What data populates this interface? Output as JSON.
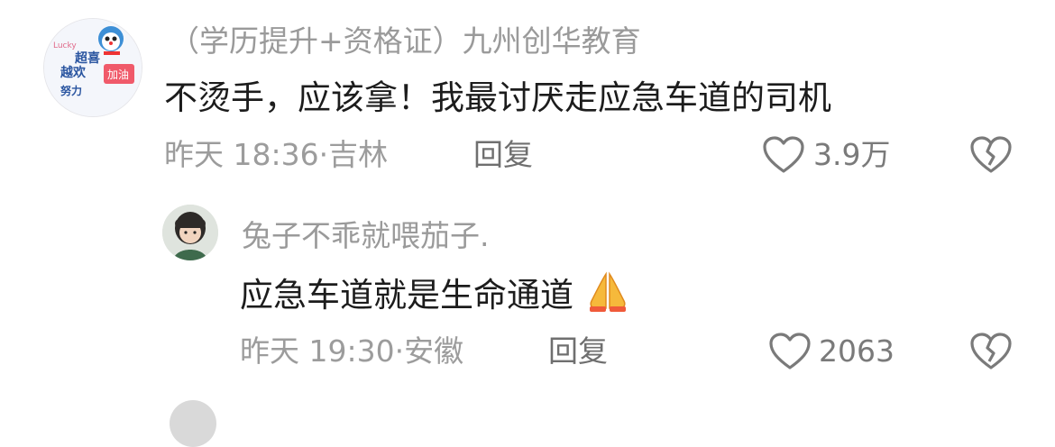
{
  "comment": {
    "author": "（学历提升+资格证）九州创华教育",
    "text": "不烫手，应该拿！我最讨厌走应急车道的司机",
    "time": "昨天 18:36·",
    "location": "吉林",
    "reply_label": "回复",
    "like_count": "3.9万",
    "avatar": {
      "text_lines": [
        "超喜",
        "越欢",
        "努力"
      ],
      "badge": "加油",
      "tag": "Lucky"
    }
  },
  "reply": {
    "author": "兔子不乖就喂茄子.",
    "text": "应急车道就是生命通道",
    "emoji": "🙏",
    "time": "昨天 19:30·",
    "location": "安徽",
    "reply_label": "回复",
    "like_count": "2063"
  },
  "icons": {
    "like": "heart-outline-icon",
    "dislike": "broken-heart-icon",
    "emoji": "folded-hands-emoji"
  },
  "colors": {
    "text_primary": "#1c1c1c",
    "text_secondary": "#9a9a9a",
    "avatar_badge": "#f05a6a",
    "emoji_fill": "#f6b93b"
  }
}
